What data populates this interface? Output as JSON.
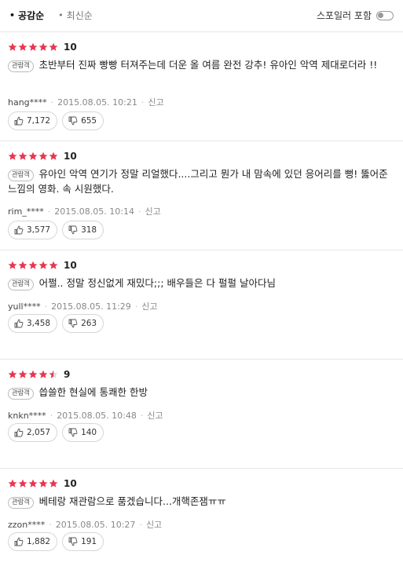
{
  "sort": {
    "active": "공감순",
    "inactive": "최신순"
  },
  "spoiler": {
    "label": "스포일러 포함",
    "enabled": false
  },
  "colors": {
    "star": "#e8364f",
    "star_empty": "#d8d8d8"
  },
  "reviews": [
    {
      "stars": 5,
      "score": "10",
      "badge": "관람객",
      "text": "초반부터 진짜 빵빵 터져주는데 더운 올 여름 완전 강추! 유아인 악역 제대로더라 !!",
      "author": "hang****",
      "date": "2015.08.05. 10:21",
      "report": "신고",
      "likes": "7,172",
      "dislikes": "655"
    },
    {
      "stars": 5,
      "score": "10",
      "badge": "관람객",
      "text": "유아인 악역 연기가 정말 리얼했다....그리고 뭔가 내 맘속에 있던 응어리를 뻥! 뚫어준 느낌의 영화. 속 시원했다.",
      "author": "rim_****",
      "date": "2015.08.05. 10:14",
      "report": "신고",
      "likes": "3,577",
      "dislikes": "318"
    },
    {
      "stars": 5,
      "score": "10",
      "badge": "관람객",
      "text": "어쩔.. 정말 정신없게 재밌다;;; 배우들은 다 펄펄 날아다님",
      "author": "yull****",
      "date": "2015.08.05. 11:29",
      "report": "신고",
      "likes": "3,458",
      "dislikes": "263"
    },
    {
      "stars": 4.5,
      "score": "9",
      "badge": "관람객",
      "text": "씁쓸한 현실에 통쾌한 한방",
      "author": "knkn****",
      "date": "2015.08.05. 10:48",
      "report": "신고",
      "likes": "2,057",
      "dislikes": "140"
    },
    {
      "stars": 5,
      "score": "10",
      "badge": "관람객",
      "text": "베테랑 재관람으로 품겠습니다...개핵존잼ㅠㅠ",
      "author": "zzon****",
      "date": "2015.08.05. 10:27",
      "report": "신고",
      "likes": "1,882",
      "dislikes": "191"
    }
  ]
}
